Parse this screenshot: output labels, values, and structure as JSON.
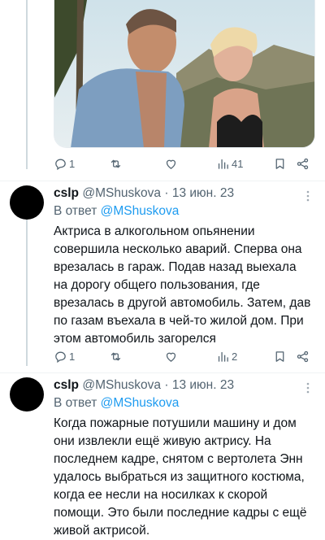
{
  "first_tweet": {
    "image_alt": "photo",
    "stats": {
      "replies": "1",
      "retweets": "",
      "likes": "",
      "views": "41"
    }
  },
  "tweets": [
    {
      "name": "cslp",
      "handle": "@MShuskova",
      "sep": "·",
      "date": "13 июн. 23",
      "reply_prefix": "В ответ",
      "reply_to": "@MShuskova",
      "text": "Актриса в алкогольном опьянении\nсовершила несколько аварий. Сперва она\nврезалась в гараж. Подав назад выехала\nна дорогу общего пользования, где\nврезалась в другой автомобиль.  Затем, дав\nпо газам въехала в чей-то жилой дом. При\nэтом автомобиль загорелся",
      "stats": {
        "replies": "1",
        "retweets": "",
        "likes": "",
        "views": "2"
      }
    },
    {
      "name": "cslp",
      "handle": "@MShuskova",
      "sep": "·",
      "date": "13 июн. 23",
      "reply_prefix": "В ответ",
      "reply_to": "@MShuskova",
      "text": "Когда пожарные потушили машину и дом\nони извлекли ещё живую актрису. На\nпоследнем кадре, снятом с вертолета  Энн\nудалось выбраться из защитного костюма,\nкогда ее несли на носилках к скорой\nпомощи. Это были последние кадры с ещё\nживой актрисой."
    }
  ],
  "icons": {
    "reply": "reply-icon",
    "retweet": "retweet-icon",
    "like": "heart-icon",
    "views": "views-icon",
    "bookmark": "bookmark-icon",
    "share": "share-icon",
    "more": "more-icon"
  },
  "colors": {
    "text": "#0f1419",
    "muted": "#536471",
    "link": "#1d9bf0",
    "line": "#cfd9de"
  }
}
